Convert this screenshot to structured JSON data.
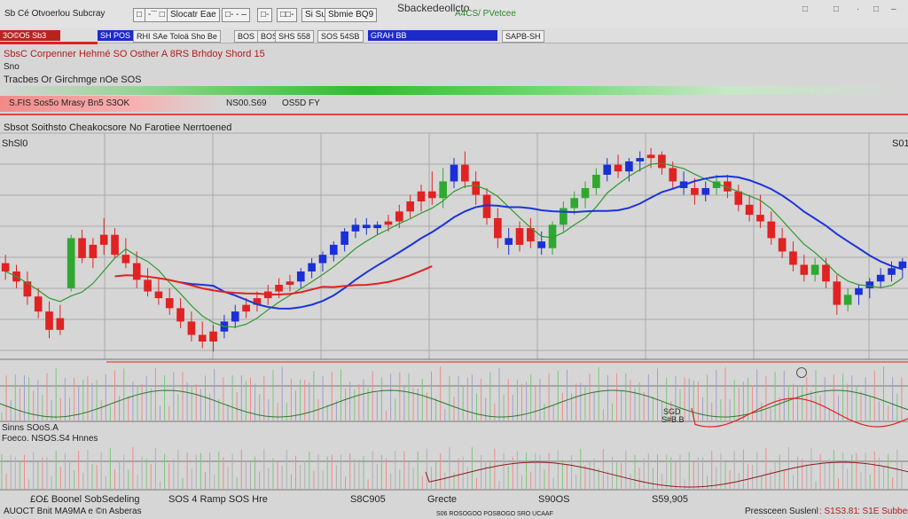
{
  "topbar": {
    "items": [
      "Sb Cé Otvoerlou Subcray",
      "□",
      "-¨¨ □",
      "Slocatr Eae",
      "□- - –",
      "□-",
      "□□-",
      "Si Sub",
      "Sbmie BQ9"
    ],
    "title": "Sbackedeollcto",
    "ticker": "A4CS/ PVetcee",
    "right_icons": [
      "□",
      "□",
      "·",
      "□",
      "–"
    ]
  },
  "toolbar2": {
    "label_red": "3O©O5 Sb3",
    "label_blue_small": "SH POS",
    "tabs": [
      "RHI SAe Toloä Sho Be",
      "BOS",
      "BOS",
      "SHS 558",
      "SOS 54SB"
    ],
    "active_tab": "GRAH BB",
    "right_tab": "SAPB-SH"
  },
  "info": {
    "line1": "SbsC Corpenner Hehmé SO Osther A 8RS Brhdoy Shord 15",
    "line2": "Sno",
    "line3": "Tracbes Or Girchmge nOe SOS",
    "banner_text": "S.FIS Sos5o Mrasy Bn5 S3OK",
    "banner_mid": "NS00.S69",
    "banner_right": "OS5D FY",
    "section_title": "Sbsot Soithsto Cheakocsore No Farotiee Nerrtoened",
    "price_left": "ShSl0",
    "price_right": "S01"
  },
  "indicators": {
    "label_a": "Sinns SOoS.A",
    "label_b": "Foeco. NSOS.S4 Hnnes",
    "label_c": "SGD",
    "label_d": "S#B.B"
  },
  "bottom": {
    "left1": "£O£ Boonel SobSedeling",
    "left2": "AUOCT Bnit MA9MA e ©n Asberas",
    "b1": "SOS 4 Ramp SOS Hre",
    "b2": "S8C905",
    "b3": "Grecte",
    "b4": "S90OS",
    "b5": "S59,905",
    "b6": "S06 ROSOGOO POSBOGO SRO UCAAF",
    "right_a": "Pressceen Suslenl",
    "right_b": ": S1S3.81",
    "right_c": ": S1E Subbero"
  },
  "colors": {
    "up": "#2fa82f",
    "down": "#e02222",
    "blue_candle": "#1a2fd6",
    "ma_blue": "#1a35d8",
    "ma_red": "#e02222",
    "ma_green": "#2e9a2e",
    "grid": "#a9a9a9"
  },
  "chart_data": {
    "type": "candlestick",
    "title": "",
    "ylim": [
      0,
      100
    ],
    "candles": [
      {
        "o": 55,
        "h": 60,
        "l": 45,
        "c": 50,
        "color": "down"
      },
      {
        "o": 50,
        "h": 54,
        "l": 40,
        "c": 44,
        "color": "down"
      },
      {
        "o": 44,
        "h": 50,
        "l": 30,
        "c": 35,
        "color": "down"
      },
      {
        "o": 35,
        "h": 40,
        "l": 22,
        "c": 26,
        "color": "down"
      },
      {
        "o": 26,
        "h": 32,
        "l": 10,
        "c": 15,
        "color": "down"
      },
      {
        "o": 15,
        "h": 30,
        "l": 12,
        "c": 22,
        "color": "down"
      },
      {
        "o": 40,
        "h": 72,
        "l": 38,
        "c": 70,
        "color": "up"
      },
      {
        "o": 70,
        "h": 75,
        "l": 55,
        "c": 58,
        "color": "down"
      },
      {
        "o": 58,
        "h": 70,
        "l": 52,
        "c": 66,
        "color": "down"
      },
      {
        "o": 66,
        "h": 82,
        "l": 60,
        "c": 72,
        "color": "down"
      },
      {
        "o": 72,
        "h": 76,
        "l": 58,
        "c": 60,
        "color": "down"
      },
      {
        "o": 60,
        "h": 70,
        "l": 52,
        "c": 55,
        "color": "down"
      },
      {
        "o": 55,
        "h": 62,
        "l": 40,
        "c": 45,
        "color": "down"
      },
      {
        "o": 45,
        "h": 52,
        "l": 35,
        "c": 38,
        "color": "down"
      },
      {
        "o": 38,
        "h": 46,
        "l": 30,
        "c": 34,
        "color": "down"
      },
      {
        "o": 34,
        "h": 40,
        "l": 24,
        "c": 28,
        "color": "down"
      },
      {
        "o": 28,
        "h": 34,
        "l": 16,
        "c": 20,
        "color": "down"
      },
      {
        "o": 20,
        "h": 26,
        "l": 8,
        "c": 12,
        "color": "down"
      },
      {
        "o": 12,
        "h": 20,
        "l": 4,
        "c": 8,
        "color": "down"
      },
      {
        "o": 8,
        "h": 18,
        "l": 2,
        "c": 14,
        "color": "down"
      },
      {
        "o": 14,
        "h": 24,
        "l": 10,
        "c": 20,
        "color": "blue"
      },
      {
        "o": 20,
        "h": 30,
        "l": 16,
        "c": 26,
        "color": "blue"
      },
      {
        "o": 26,
        "h": 34,
        "l": 22,
        "c": 30,
        "color": "down"
      },
      {
        "o": 30,
        "h": 38,
        "l": 26,
        "c": 34,
        "color": "down"
      },
      {
        "o": 34,
        "h": 42,
        "l": 30,
        "c": 38,
        "color": "down"
      },
      {
        "o": 38,
        "h": 46,
        "l": 34,
        "c": 42,
        "color": "down"
      },
      {
        "o": 42,
        "h": 48,
        "l": 38,
        "c": 44,
        "color": "down"
      },
      {
        "o": 44,
        "h": 52,
        "l": 40,
        "c": 50,
        "color": "blue"
      },
      {
        "o": 50,
        "h": 58,
        "l": 46,
        "c": 55,
        "color": "blue"
      },
      {
        "o": 55,
        "h": 62,
        "l": 50,
        "c": 60,
        "color": "blue"
      },
      {
        "o": 60,
        "h": 68,
        "l": 56,
        "c": 66,
        "color": "blue"
      },
      {
        "o": 66,
        "h": 76,
        "l": 62,
        "c": 74,
        "color": "blue"
      },
      {
        "o": 74,
        "h": 82,
        "l": 70,
        "c": 78,
        "color": "blue"
      },
      {
        "o": 78,
        "h": 82,
        "l": 72,
        "c": 76,
        "color": "blue"
      },
      {
        "o": 76,
        "h": 80,
        "l": 72,
        "c": 78,
        "color": "blue"
      },
      {
        "o": 78,
        "h": 84,
        "l": 74,
        "c": 80,
        "color": "down"
      },
      {
        "o": 80,
        "h": 90,
        "l": 76,
        "c": 86,
        "color": "down"
      },
      {
        "o": 86,
        "h": 96,
        "l": 82,
        "c": 92,
        "color": "down"
      },
      {
        "o": 92,
        "h": 102,
        "l": 86,
        "c": 98,
        "color": "down"
      },
      {
        "o": 98,
        "h": 110,
        "l": 90,
        "c": 94,
        "color": "down"
      },
      {
        "o": 94,
        "h": 112,
        "l": 88,
        "c": 104,
        "color": "up"
      },
      {
        "o": 104,
        "h": 118,
        "l": 100,
        "c": 114,
        "color": "blue"
      },
      {
        "o": 114,
        "h": 122,
        "l": 100,
        "c": 104,
        "color": "down"
      },
      {
        "o": 104,
        "h": 110,
        "l": 90,
        "c": 96,
        "color": "down"
      },
      {
        "o": 96,
        "h": 100,
        "l": 78,
        "c": 82,
        "color": "down"
      },
      {
        "o": 82,
        "h": 88,
        "l": 64,
        "c": 70,
        "color": "down"
      },
      {
        "o": 70,
        "h": 76,
        "l": 60,
        "c": 66,
        "color": "blue"
      },
      {
        "o": 66,
        "h": 80,
        "l": 62,
        "c": 76,
        "color": "down"
      },
      {
        "o": 76,
        "h": 82,
        "l": 64,
        "c": 68,
        "color": "down"
      },
      {
        "o": 68,
        "h": 74,
        "l": 60,
        "c": 64,
        "color": "blue"
      },
      {
        "o": 64,
        "h": 80,
        "l": 60,
        "c": 78,
        "color": "up"
      },
      {
        "o": 78,
        "h": 92,
        "l": 74,
        "c": 88,
        "color": "up"
      },
      {
        "o": 88,
        "h": 98,
        "l": 84,
        "c": 94,
        "color": "up"
      },
      {
        "o": 94,
        "h": 104,
        "l": 88,
        "c": 100,
        "color": "up"
      },
      {
        "o": 100,
        "h": 112,
        "l": 96,
        "c": 108,
        "color": "up"
      },
      {
        "o": 108,
        "h": 118,
        "l": 104,
        "c": 114,
        "color": "blue"
      },
      {
        "o": 114,
        "h": 120,
        "l": 106,
        "c": 110,
        "color": "down"
      },
      {
        "o": 110,
        "h": 118,
        "l": 104,
        "c": 116,
        "color": "blue"
      },
      {
        "o": 116,
        "h": 122,
        "l": 110,
        "c": 118,
        "color": "blue"
      },
      {
        "o": 118,
        "h": 124,
        "l": 112,
        "c": 120,
        "color": "down"
      },
      {
        "o": 120,
        "h": 122,
        "l": 108,
        "c": 112,
        "color": "down"
      },
      {
        "o": 112,
        "h": 116,
        "l": 100,
        "c": 104,
        "color": "down"
      },
      {
        "o": 104,
        "h": 110,
        "l": 96,
        "c": 100,
        "color": "blue"
      },
      {
        "o": 100,
        "h": 106,
        "l": 90,
        "c": 96,
        "color": "down"
      },
      {
        "o": 96,
        "h": 104,
        "l": 92,
        "c": 100,
        "color": "blue"
      },
      {
        "o": 100,
        "h": 108,
        "l": 96,
        "c": 104,
        "color": "up"
      },
      {
        "o": 104,
        "h": 108,
        "l": 94,
        "c": 98,
        "color": "down"
      },
      {
        "o": 98,
        "h": 102,
        "l": 86,
        "c": 90,
        "color": "down"
      },
      {
        "o": 90,
        "h": 96,
        "l": 80,
        "c": 84,
        "color": "down"
      },
      {
        "o": 84,
        "h": 96,
        "l": 76,
        "c": 80,
        "color": "down"
      },
      {
        "o": 80,
        "h": 86,
        "l": 66,
        "c": 70,
        "color": "down"
      },
      {
        "o": 70,
        "h": 76,
        "l": 58,
        "c": 62,
        "color": "down"
      },
      {
        "o": 62,
        "h": 68,
        "l": 50,
        "c": 54,
        "color": "down"
      },
      {
        "o": 54,
        "h": 60,
        "l": 44,
        "c": 48,
        "color": "down"
      },
      {
        "o": 48,
        "h": 58,
        "l": 44,
        "c": 54,
        "color": "up"
      },
      {
        "o": 54,
        "h": 58,
        "l": 40,
        "c": 44,
        "color": "down"
      },
      {
        "o": 44,
        "h": 48,
        "l": 24,
        "c": 30,
        "color": "down"
      },
      {
        "o": 30,
        "h": 40,
        "l": 26,
        "c": 36,
        "color": "up"
      },
      {
        "o": 36,
        "h": 42,
        "l": 30,
        "c": 40,
        "color": "blue"
      },
      {
        "o": 40,
        "h": 46,
        "l": 34,
        "c": 44,
        "color": "blue"
      },
      {
        "o": 44,
        "h": 52,
        "l": 40,
        "c": 48,
        "color": "blue"
      },
      {
        "o": 48,
        "h": 56,
        "l": 44,
        "c": 52,
        "color": "blue"
      },
      {
        "o": 52,
        "h": 58,
        "l": 46,
        "c": 56,
        "color": "blue"
      }
    ]
  }
}
